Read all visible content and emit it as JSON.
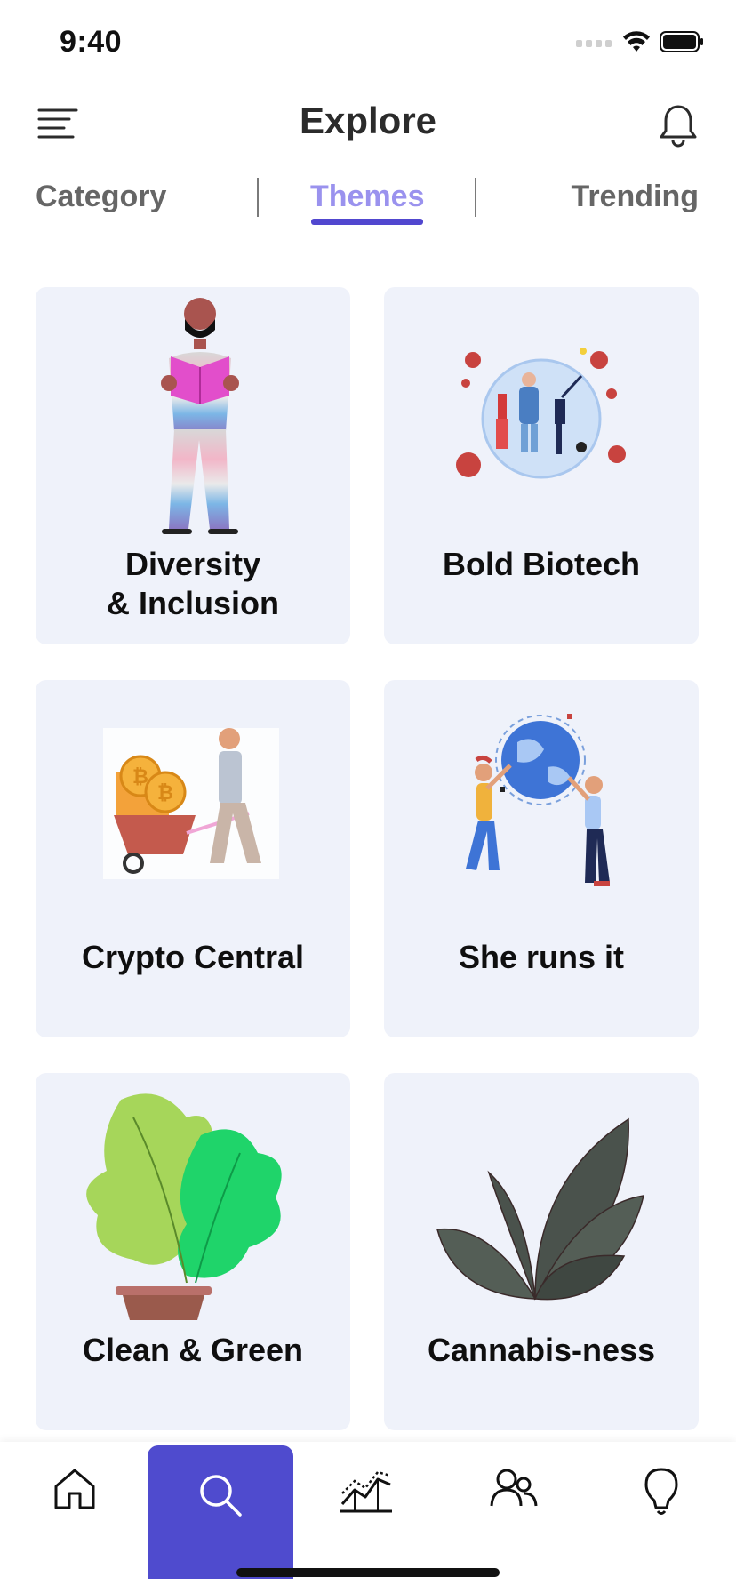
{
  "status_bar": {
    "time": "9:40"
  },
  "header": {
    "title": "Explore"
  },
  "tabs": [
    {
      "label": "Category"
    },
    {
      "label": "Themes"
    },
    {
      "label": "Trending"
    }
  ],
  "active_tab": "Themes",
  "themes": [
    {
      "label_line1": "Diversity",
      "label_line2": "& Inclusion",
      "icon": "person-reading-illustration"
    },
    {
      "label": "Bold Biotech",
      "icon": "globe-virus-illustration"
    },
    {
      "label": "Crypto Central",
      "icon": "bitcoin-wheelbarrow-illustration"
    },
    {
      "label": "She runs it",
      "icon": "women-globe-illustration"
    },
    {
      "label": "Clean & Green",
      "icon": "potted-plant-illustration"
    },
    {
      "label": "Cannabis-ness",
      "icon": "leaves-illustration"
    }
  ],
  "bottom_nav": [
    {
      "icon": "home-icon"
    },
    {
      "icon": "search-icon",
      "active": true
    },
    {
      "icon": "chart-icon"
    },
    {
      "icon": "people-icon"
    },
    {
      "icon": "lightbulb-icon"
    }
  ],
  "colors": {
    "accent": "#4f4bce",
    "active_tab_text": "#9a92ee",
    "card_bg": "#eff2fa"
  }
}
